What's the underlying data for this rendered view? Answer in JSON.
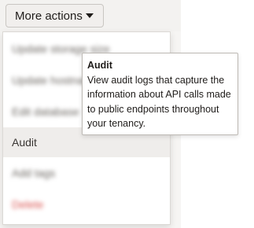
{
  "toolbar": {
    "more_actions_label": "More actions"
  },
  "menu": {
    "items": [
      {
        "label": "Update storage size"
      },
      {
        "label": "Update hostname"
      },
      {
        "label": "Edit database"
      },
      {
        "label": "Audit"
      },
      {
        "label": "Add tags"
      },
      {
        "label": "Delete"
      }
    ]
  },
  "tooltip": {
    "title": "Audit",
    "body": "View audit logs that capture the information about API calls made to public endpoints throughout your tenancy."
  },
  "colors": {
    "danger": "#d9534f",
    "active_row": "#efedeb"
  }
}
